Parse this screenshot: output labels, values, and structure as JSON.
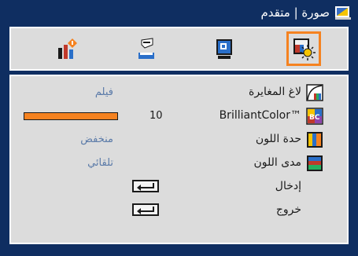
{
  "window": {
    "title": "صورة | متقدم"
  },
  "tabs": [
    {
      "name": "info",
      "active": false
    },
    {
      "name": "settings",
      "active": false
    },
    {
      "name": "display",
      "active": false
    },
    {
      "name": "image",
      "active": true
    }
  ],
  "menu": {
    "items": [
      {
        "label": "لاغ المغايرة",
        "value": "فيلم",
        "type": "value"
      },
      {
        "label": "BrilliantColor™",
        "value": "10",
        "type": "slider",
        "level": 10
      },
      {
        "label": "حدة اللون",
        "value": "منخفض",
        "type": "value"
      },
      {
        "label": "مدى اللون",
        "value": "تلقائي",
        "type": "value"
      },
      {
        "label": "إدخال",
        "type": "enter"
      },
      {
        "label": "خروج",
        "type": "enter"
      }
    ]
  },
  "colors": {
    "frame": "#0f2e61",
    "panel": "#dcdcdc",
    "accent": "#f58220",
    "value_text": "#5a7aa8"
  }
}
